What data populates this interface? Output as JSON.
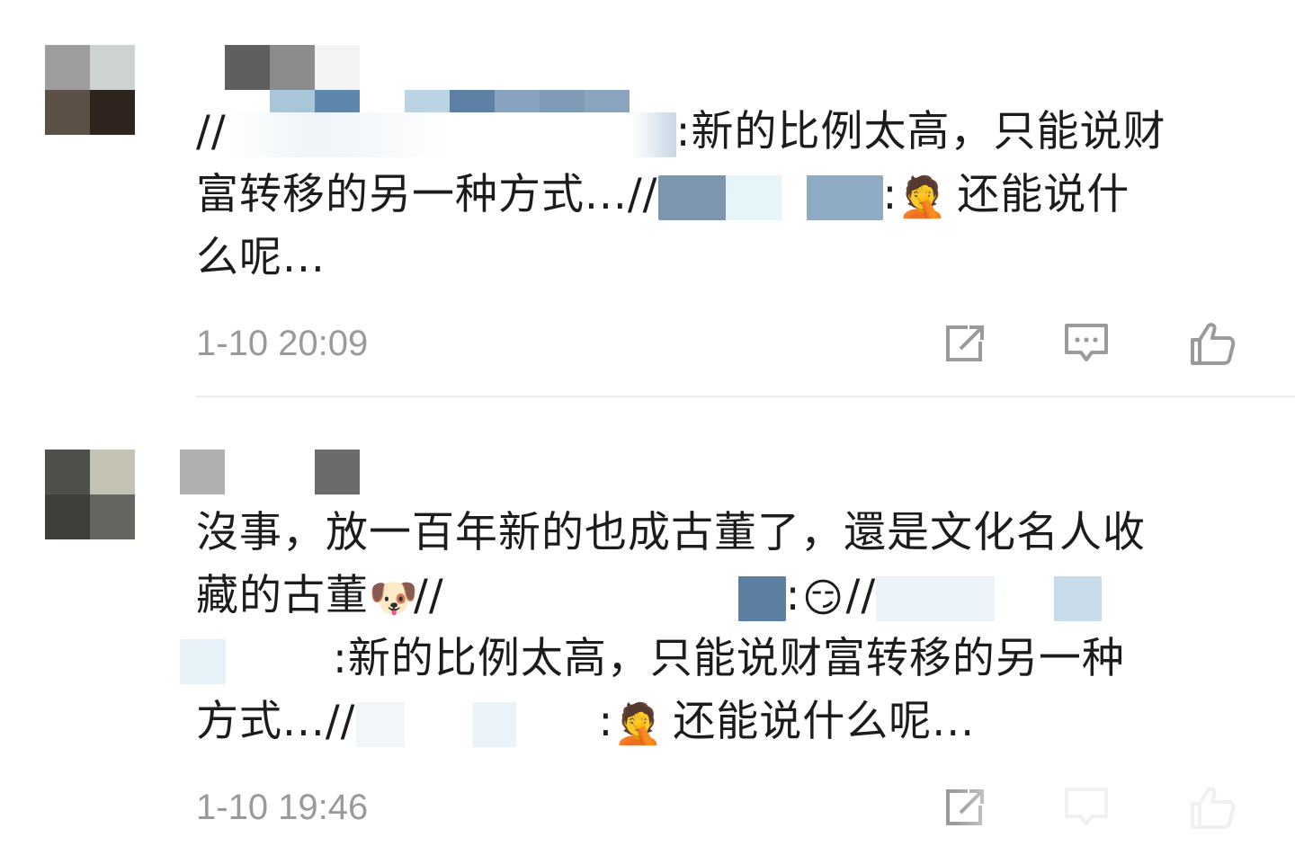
{
  "comments": [
    {
      "text_line1_a": "//",
      "text_line1_b": ":新的比例太高，只能说财",
      "text_line2_a": "富转移的另一种方式...//",
      "text_line2_b": ":",
      "text_line2_c": " 还能说什",
      "text_line3": "么呢...",
      "timestamp": "1-10 20:09",
      "emoji_1": "facepalm-emoji"
    },
    {
      "text_line1": "沒事，放一百年新的也成古董了，還是文化名人收",
      "text_line2_a": "藏的古董",
      "text_line2_b": "//",
      "text_line2_c": ":",
      "text_line2_d": "//",
      "text_line3_b": ":新的比例太高，只能说财富转移的另一种",
      "text_line4_a": "方式...//",
      "text_line4_b": ":",
      "text_line4_c": " 还能说什么呢...",
      "timestamp": "1-10 19:46",
      "emoji_doge": "doge-emoji",
      "emoji_smirk": "smirk-emoji",
      "emoji_facepalm": "facepalm-emoji"
    }
  ],
  "actions": {
    "share_icon": "share-icon",
    "reply_icon": "reply-icon",
    "like_icon": "thumbs-up-icon",
    "icon_color": "#9a9a9a"
  }
}
